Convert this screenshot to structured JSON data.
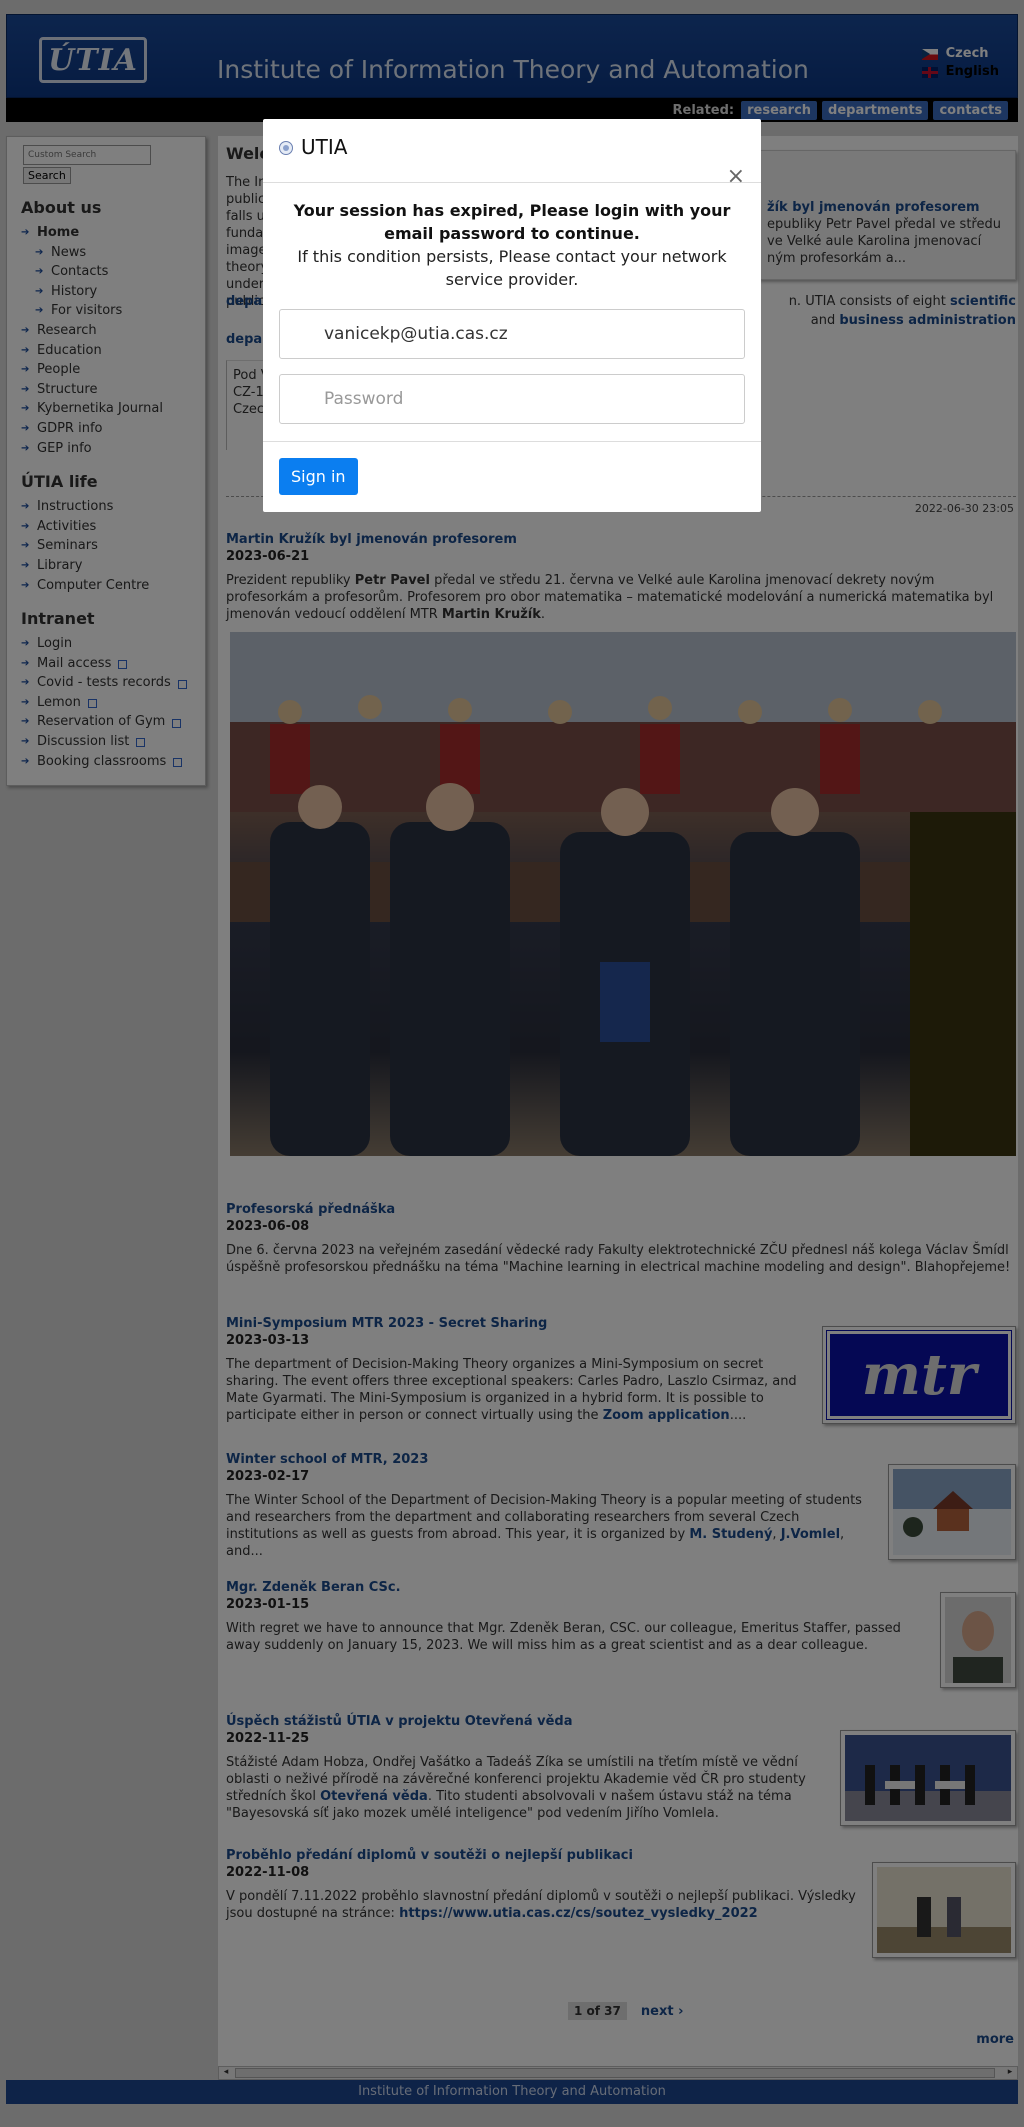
{
  "header": {
    "logo_text": "ÚTIA",
    "site_title": "Institute of Information Theory and Automation",
    "lang_czech": "Czech",
    "lang_english": "English"
  },
  "related": {
    "label": "Related:",
    "links": [
      "research",
      "departments",
      "contacts"
    ]
  },
  "sidebar": {
    "search_placeholder": "Custom Search",
    "search_button": "Search",
    "about_heading": "About us",
    "about_items": [
      {
        "label": "Home",
        "level": 0,
        "active": true
      },
      {
        "label": "News",
        "level": 1
      },
      {
        "label": "Contacts",
        "level": 1
      },
      {
        "label": "History",
        "level": 1
      },
      {
        "label": "For visitors",
        "level": 1
      },
      {
        "label": "Research",
        "level": 0
      },
      {
        "label": "Education",
        "level": 0
      },
      {
        "label": "People",
        "level": 0
      },
      {
        "label": "Structure",
        "level": 0
      },
      {
        "label": "Kybernetika Journal",
        "level": 0
      },
      {
        "label": "GDPR info",
        "level": 0
      },
      {
        "label": "GEP info",
        "level": 0
      }
    ],
    "life_heading": "ÚTIA life",
    "life_items": [
      "Instructions",
      "Activities",
      "Seminars",
      "Library",
      "Computer Centre"
    ],
    "intranet_heading": "Intranet",
    "intranet_items": [
      {
        "label": "Login",
        "external": false
      },
      {
        "label": "Mail access",
        "external": true
      },
      {
        "label": "Covid - tests records",
        "external": true
      },
      {
        "label": "Lemon",
        "external": true
      },
      {
        "label": "Reservation of Gym",
        "external": true
      },
      {
        "label": "Discussion list",
        "external": true
      },
      {
        "label": "Booking classrooms",
        "external": true
      }
    ]
  },
  "main": {
    "welcome_title": "Welc",
    "welcome_text": "The In\npublic\nfalls u\nfunda\nimage\ntheory\nunder\npublic",
    "feature_title": "žík byl jmenován profesorem",
    "feature_text": "epubliky Petr Pavel předal ve středu\nve Velké aule Karolina jmenovací\nným profesorkám a...",
    "org_text_start": "depa",
    "org_text_mid": "n. UTIA consists of eight",
    "org_link_1": "scientific",
    "org_and": "and",
    "org_link_2": "business administration",
    "org_text_line3": "depa",
    "address": [
      "Pod V",
      "CZ-1",
      "Czec"
    ],
    "timestamp": "2022-06-30 23:05"
  },
  "news": [
    {
      "title": "Martin Kružík byl jmenován profesorem",
      "date": "2023-06-21",
      "body_html": "Prezident republiky <b>Petr Pavel</b> předal ve středu 21. června ve Velké aule Karolina jmenovací dekrety novým profesorkám a profesorům. Profesorem pro obor matematika – matematické modelování a numerická matematika byl jmenován vedoucí oddělení MTR <b>Martin Kružík</b>."
    },
    {
      "title": "Profesorská přednáška",
      "date": "2023-06-08",
      "body_html": "Dne 6. června 2023 na veřejném zasedání vědecké rady Fakulty elektrotechnické ZČU přednesl náš kolega Václav Šmídl úspěšně profesorskou přednášku na téma  \"Machine learning in electrical machine modeling and design\". Blahopřejeme!"
    },
    {
      "title": "Mini-Symposium MTR 2023 - Secret Sharing",
      "date": "2023-03-13",
      "body_html": "The department of Decision-Making Theory organizes a Mini-Symposium on secret sharing. The event offers three exceptional speakers: Carles Padro, Laszlo Csirmaz, and Mate Gyarmati. The Mini-Symposium is organized in a hybrid form. It is possible to participate either in person or connect virtually using the <span class=\"lnk\">Zoom application</span>....",
      "thumb_text": "mtr"
    },
    {
      "title": "Winter school of MTR, 2023",
      "date": "2023-02-17",
      "body_html": "The Winter School of the Department of Decision-Making Theory is a popular meeting of students and researchers from the department and collaborating researchers from several Czech institutions as well as guests from abroad. This year, it is organized by  <span class=\"lnk\">M. Studený</span>, <span class=\"lnk\">J.Vomlel</span>, and..."
    },
    {
      "title": "Mgr. Zdeněk Beran CSc.",
      "date": "2023-01-15",
      "body_html": "With regret we have to announce that Mgr. Zdeněk Beran, CSC. our colleague, Emeritus Staffer,  passed away suddenly on January 15, 2023. We will miss him as a great scientist and as a dear colleague."
    },
    {
      "title": "Úspěch stážistů ÚTIA v projektu Otevřená věda",
      "date": "2022-11-25",
      "body_html": "Stážisté Adam Hobza, Ondřej Vašátko a Tadeáš Zíka se umístili na třetím místě ve vědní oblasti o neživé přírodě na závěrečné konferenci projektu Akademie věd ČR pro studenty středních škol <span class=\"lnk\">Otevřená věda</span>. Tito studenti absolvovali v našem ústavu stáž na téma \"Bayesovská síť jako mozek umělé inteligence\" pod vedením Jiřího Vomlela."
    },
    {
      "title": "Proběhlo předání diplomů v soutěži o nejlepší publikaci",
      "date": "2022-11-08",
      "body_html": "V pondělí 7.11.2022 proběhlo slavnostní předání diplomů v soutěži o nejlepší publikaci. Výsledky jsou dostupné na stránce: <span class=\"lnk\">https://www.utia.cas.cz/cs/soutez_vysledky_2022</span>"
    }
  ],
  "pager": {
    "count": "1 of 37",
    "next": "next ›",
    "more": "more"
  },
  "footer": {
    "text": "Institute of Information Theory and Automation"
  },
  "modal": {
    "title": "UTIA",
    "close": "×",
    "message_bold": "Your session has expired, Please login with your email password to continue.",
    "message": "If this condition persists, Please contact your network service provider.",
    "email_value": "vanicekp@utia.cas.cz",
    "password_placeholder": "Password",
    "signin_label": "Sign in"
  },
  "colors": {
    "header_blue": "#0c3783",
    "link_blue": "#1a4a8c",
    "signin_blue": "#0b7ef0"
  }
}
